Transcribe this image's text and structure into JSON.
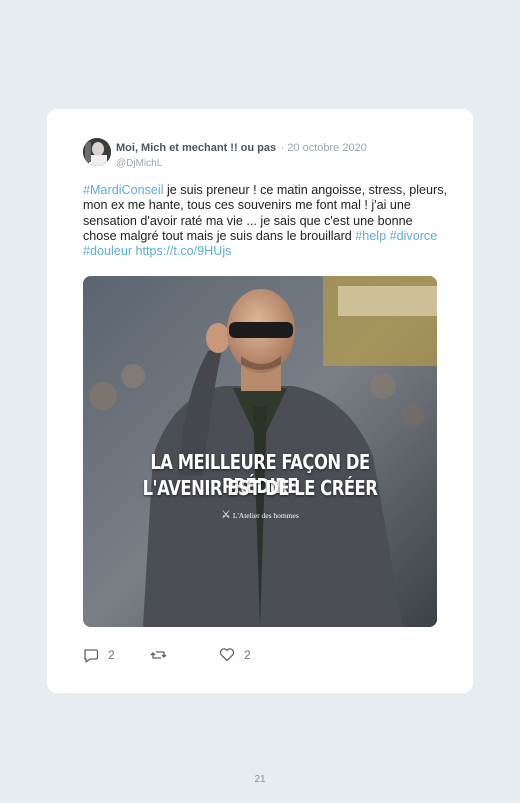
{
  "tweet": {
    "display_name": "Moi, Mich et mechant !! ou pas",
    "date": "· 20 octobre 2020",
    "handle": "@DjMichL",
    "text": {
      "hashtag_mardi": "#MardiConseil",
      "body": " je suis preneur ! ce matin angoisse, stress, pleurs, mon ex me hante, tous ces souvenirs me font mal ! j'ai une sensation d'avoir raté ma vie ... je sais que c'est une bonne chose malgré tout mais je suis dans le brouillard ",
      "hashtag_help": "#help",
      "hashtag_divorce": "#divorce",
      "hashtag_douleur": "#douleur",
      "link": "https://t.co/9HUjs"
    },
    "image": {
      "line1": "LA MEILLEURE FAÇON DE PRÉDIRE",
      "line2": "L'AVENIR EST DE LE CRÉER",
      "brand": "L'Atelier des hommes"
    },
    "actions": {
      "replies": "2",
      "likes": "2",
      "retweets": ""
    }
  },
  "page_number": "21",
  "colors": {
    "background": "#e6ecef",
    "card": "#ffffff",
    "link": "#5aaed6",
    "muted": "#9aa5b1"
  }
}
